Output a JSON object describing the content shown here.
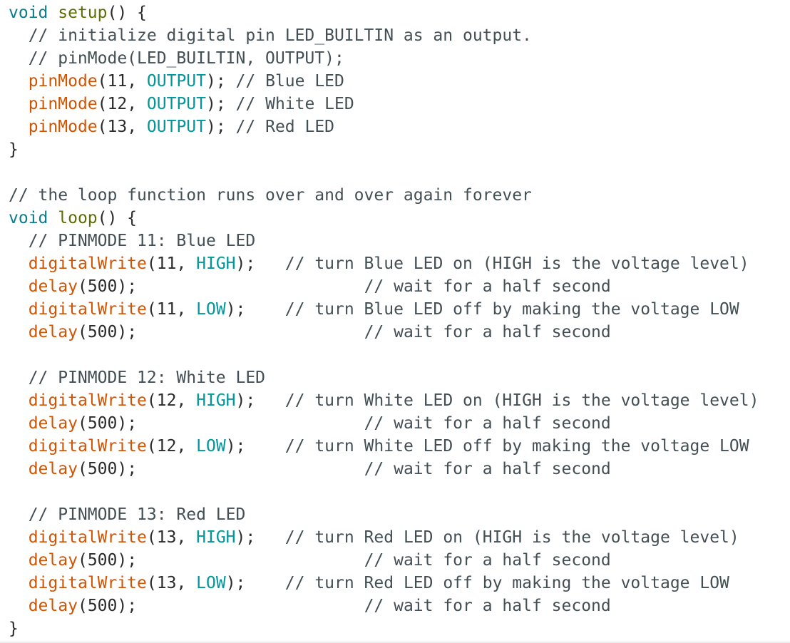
{
  "editor": {
    "language": "Arduino C++",
    "colors": {
      "keyword": "#0a7c8c",
      "function_name": "#5e6d03",
      "builtin_call": "#d35400",
      "constant": "#00979c",
      "comment": "#434f54",
      "text": "#2b2b2b"
    },
    "lines": [
      [
        [
          "kw",
          "void"
        ],
        [
          "plain",
          " "
        ],
        [
          "fn",
          "setup"
        ],
        [
          "punct",
          "() {"
        ]
      ],
      [
        [
          "comment",
          "  // initialize digital pin LED_BUILTIN as an output."
        ]
      ],
      [
        [
          "comment",
          "  // pinMode(LED_BUILTIN, OUTPUT);"
        ]
      ],
      [
        [
          "plain",
          "  "
        ],
        [
          "call",
          "pinMode"
        ],
        [
          "punct",
          "("
        ],
        [
          "num",
          "11"
        ],
        [
          "punct",
          ", "
        ],
        [
          "const",
          "OUTPUT"
        ],
        [
          "punct",
          ");"
        ],
        [
          "comment",
          " // Blue LED"
        ]
      ],
      [
        [
          "plain",
          "  "
        ],
        [
          "call",
          "pinMode"
        ],
        [
          "punct",
          "("
        ],
        [
          "num",
          "12"
        ],
        [
          "punct",
          ", "
        ],
        [
          "const",
          "OUTPUT"
        ],
        [
          "punct",
          ");"
        ],
        [
          "comment",
          " // White LED"
        ]
      ],
      [
        [
          "plain",
          "  "
        ],
        [
          "call",
          "pinMode"
        ],
        [
          "punct",
          "("
        ],
        [
          "num",
          "13"
        ],
        [
          "punct",
          ", "
        ],
        [
          "const",
          "OUTPUT"
        ],
        [
          "punct",
          ");"
        ],
        [
          "comment",
          " // Red LED"
        ]
      ],
      [
        [
          "punct",
          "}"
        ]
      ],
      [],
      [
        [
          "comment",
          "// the loop function runs over and over again forever"
        ]
      ],
      [
        [
          "kw",
          "void"
        ],
        [
          "plain",
          " "
        ],
        [
          "fn",
          "loop"
        ],
        [
          "punct",
          "() {"
        ]
      ],
      [
        [
          "comment",
          "  // PINMODE 11: Blue LED"
        ]
      ],
      [
        [
          "plain",
          "  "
        ],
        [
          "call",
          "digitalWrite"
        ],
        [
          "punct",
          "("
        ],
        [
          "num",
          "11"
        ],
        [
          "punct",
          ", "
        ],
        [
          "const",
          "HIGH"
        ],
        [
          "punct",
          ");"
        ],
        [
          "plain",
          "   "
        ],
        [
          "comment",
          "// turn Blue LED on (HIGH is the voltage level)"
        ]
      ],
      [
        [
          "plain",
          "  "
        ],
        [
          "call",
          "delay"
        ],
        [
          "punct",
          "("
        ],
        [
          "num",
          "500"
        ],
        [
          "punct",
          ");"
        ],
        [
          "plain",
          "                       "
        ],
        [
          "comment",
          "// wait for a half second"
        ]
      ],
      [
        [
          "plain",
          "  "
        ],
        [
          "call",
          "digitalWrite"
        ],
        [
          "punct",
          "("
        ],
        [
          "num",
          "11"
        ],
        [
          "punct",
          ", "
        ],
        [
          "const",
          "LOW"
        ],
        [
          "punct",
          ");"
        ],
        [
          "plain",
          "    "
        ],
        [
          "comment",
          "// turn Blue LED off by making the voltage LOW"
        ]
      ],
      [
        [
          "plain",
          "  "
        ],
        [
          "call",
          "delay"
        ],
        [
          "punct",
          "("
        ],
        [
          "num",
          "500"
        ],
        [
          "punct",
          ");"
        ],
        [
          "plain",
          "                       "
        ],
        [
          "comment",
          "// wait for a half second"
        ]
      ],
      [],
      [
        [
          "comment",
          "  // PINMODE 12: White LED"
        ]
      ],
      [
        [
          "plain",
          "  "
        ],
        [
          "call",
          "digitalWrite"
        ],
        [
          "punct",
          "("
        ],
        [
          "num",
          "12"
        ],
        [
          "punct",
          ", "
        ],
        [
          "const",
          "HIGH"
        ],
        [
          "punct",
          ");"
        ],
        [
          "plain",
          "   "
        ],
        [
          "comment",
          "// turn White LED on (HIGH is the voltage level)"
        ]
      ],
      [
        [
          "plain",
          "  "
        ],
        [
          "call",
          "delay"
        ],
        [
          "punct",
          "("
        ],
        [
          "num",
          "500"
        ],
        [
          "punct",
          ");"
        ],
        [
          "plain",
          "                       "
        ],
        [
          "comment",
          "// wait for a half second"
        ]
      ],
      [
        [
          "plain",
          "  "
        ],
        [
          "call",
          "digitalWrite"
        ],
        [
          "punct",
          "("
        ],
        [
          "num",
          "12"
        ],
        [
          "punct",
          ", "
        ],
        [
          "const",
          "LOW"
        ],
        [
          "punct",
          ");"
        ],
        [
          "plain",
          "    "
        ],
        [
          "comment",
          "// turn White LED off by making the voltage LOW"
        ]
      ],
      [
        [
          "plain",
          "  "
        ],
        [
          "call",
          "delay"
        ],
        [
          "punct",
          "("
        ],
        [
          "num",
          "500"
        ],
        [
          "punct",
          ");"
        ],
        [
          "plain",
          "                       "
        ],
        [
          "comment",
          "// wait for a half second"
        ]
      ],
      [],
      [
        [
          "comment",
          "  // PINMODE 13: Red LED"
        ]
      ],
      [
        [
          "plain",
          "  "
        ],
        [
          "call",
          "digitalWrite"
        ],
        [
          "punct",
          "("
        ],
        [
          "num",
          "13"
        ],
        [
          "punct",
          ", "
        ],
        [
          "const",
          "HIGH"
        ],
        [
          "punct",
          ");"
        ],
        [
          "plain",
          "   "
        ],
        [
          "comment",
          "// turn Red LED on (HIGH is the voltage level)"
        ]
      ],
      [
        [
          "plain",
          "  "
        ],
        [
          "call",
          "delay"
        ],
        [
          "punct",
          "("
        ],
        [
          "num",
          "500"
        ],
        [
          "punct",
          ");"
        ],
        [
          "plain",
          "                       "
        ],
        [
          "comment",
          "// wait for a half second"
        ]
      ],
      [
        [
          "plain",
          "  "
        ],
        [
          "call",
          "digitalWrite"
        ],
        [
          "punct",
          "("
        ],
        [
          "num",
          "13"
        ],
        [
          "punct",
          ", "
        ],
        [
          "const",
          "LOW"
        ],
        [
          "punct",
          ");"
        ],
        [
          "plain",
          "    "
        ],
        [
          "comment",
          "// turn Red LED off by making the voltage LOW"
        ]
      ],
      [
        [
          "plain",
          "  "
        ],
        [
          "call",
          "delay"
        ],
        [
          "punct",
          "("
        ],
        [
          "num",
          "500"
        ],
        [
          "punct",
          ");"
        ],
        [
          "plain",
          "                       "
        ],
        [
          "comment",
          "// wait for a half second"
        ]
      ],
      [
        [
          "punct",
          "}"
        ]
      ]
    ]
  }
}
